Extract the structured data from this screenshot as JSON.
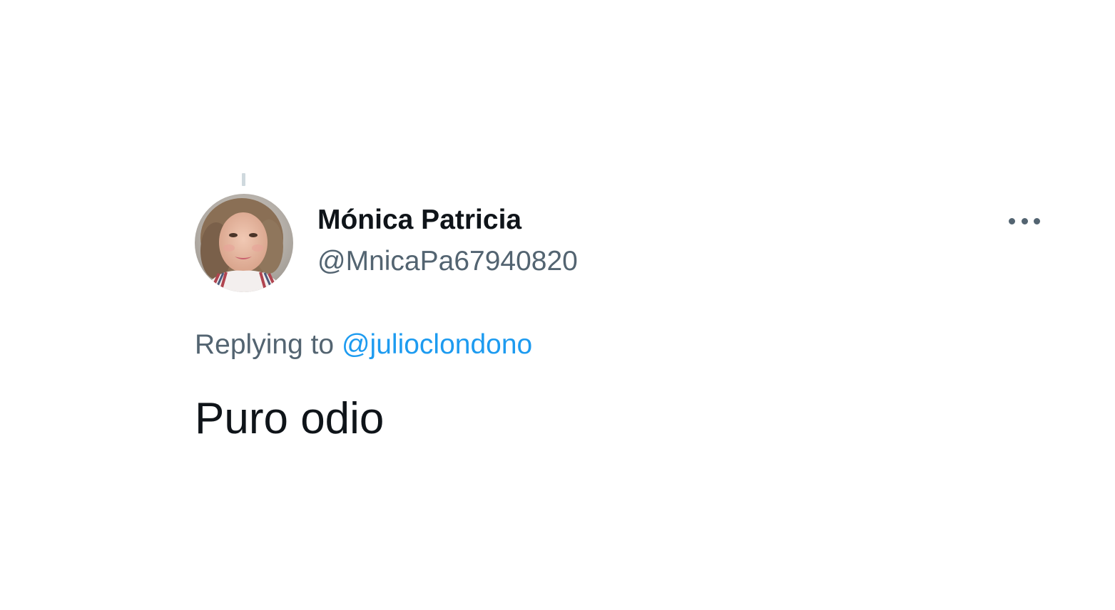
{
  "tweet": {
    "author": {
      "display_name": "Mónica Patricia",
      "handle": "@MnicaPa67940820",
      "avatar_icon": "profile-photo"
    },
    "more_icon": "more-horizontal-icon",
    "reply_context": {
      "prefix": "Replying to",
      "mention": "@julioclondono"
    },
    "text": "Puro odio"
  },
  "colors": {
    "primary_text": "#0f1419",
    "secondary_text": "#536471",
    "link": "#1d9bf0",
    "thread_line": "#cfd9de",
    "background": "#ffffff"
  }
}
